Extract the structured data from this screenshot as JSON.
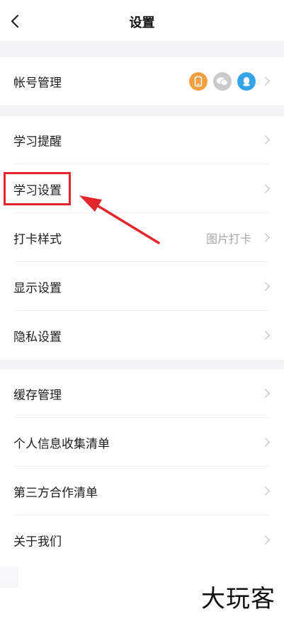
{
  "header": {
    "title": "设置"
  },
  "sections": [
    {
      "items": [
        {
          "label": "帐号管理",
          "value": "",
          "icons": [
            "phone-icon",
            "wechat-icon",
            "qq-icon"
          ]
        }
      ]
    },
    {
      "items": [
        {
          "label": "学习提醒",
          "value": ""
        },
        {
          "label": "学习设置",
          "value": ""
        },
        {
          "label": "打卡样式",
          "value": "图片打卡"
        },
        {
          "label": "显示设置",
          "value": ""
        },
        {
          "label": "隐私设置",
          "value": ""
        }
      ]
    },
    {
      "items": [
        {
          "label": "缓存管理",
          "value": ""
        },
        {
          "label": "个人信息收集清单",
          "value": ""
        },
        {
          "label": "第三方合作清单",
          "value": ""
        },
        {
          "label": "关于我们",
          "value": ""
        }
      ]
    }
  ],
  "annotation": {
    "highlight_color": "#e3262d"
  },
  "colors": {
    "phone_icon_bg": "#f3a043",
    "wechat_icon_bg": "#c9c9cc",
    "qq_icon_bg": "#36a4e8"
  },
  "watermark": {
    "text": "大玩客"
  }
}
